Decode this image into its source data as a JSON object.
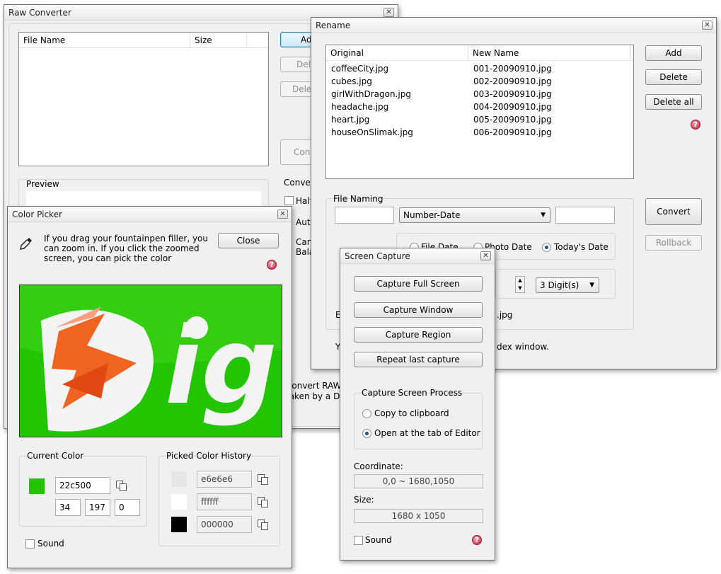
{
  "raw_converter": {
    "title": "Raw Converter",
    "columns": [
      "File Name",
      "Size"
    ],
    "buttons": {
      "add": "Add",
      "delete": "Delete",
      "delete_all": "Delete all",
      "convert": "Convert"
    },
    "preview_label": "Preview",
    "convert_group_label": "Conversion",
    "options": {
      "half": "Half",
      "auto": "Auto",
      "camera_balance": "Camera",
      "balance": "Balance"
    },
    "description": [
      "Convert RAW to",
      "taken by a DSLR"
    ]
  },
  "rename": {
    "title": "Rename",
    "columns": {
      "original": "Original",
      "new_name": "New Name"
    },
    "rows": [
      {
        "original": "coffeeCity.jpg",
        "new_name": "001-20090910.jpg"
      },
      {
        "original": "cubes.jpg",
        "new_name": "002-20090910.jpg"
      },
      {
        "original": "girlWithDragon.jpg",
        "new_name": "003-20090910.jpg"
      },
      {
        "original": "headache.jpg",
        "new_name": "004-20090910.jpg"
      },
      {
        "original": "heart.jpg",
        "new_name": "005-20090910.jpg"
      },
      {
        "original": "houseOnSlimak.jpg",
        "new_name": "006-20090910.jpg"
      }
    ],
    "buttons": {
      "add": "Add",
      "delete": "Delete",
      "delete_all": "Delete all",
      "convert": "Convert",
      "rollback": "Rollback"
    },
    "file_naming_label": "File Naming",
    "naming_select": "Number-Date",
    "date_options": {
      "file_date": "File Date",
      "photo_date": "Photo Date",
      "todays_date": "Today's Date"
    },
    "digits_select": "3 Digit(s)",
    "example_prefix": "E",
    "example_suffix": ".jpg",
    "footer_prefix": "Y",
    "footer_suffix": "dex window."
  },
  "color_picker": {
    "title": "Color Picker",
    "close_label": "Close",
    "instructions": [
      "If you drag your fountainpen filler, you",
      "can zoom in. If you click the zoomed",
      "screen, you can pick the color"
    ],
    "zoom_text": "ig",
    "current_color_label": "Current Color",
    "hex": "22c500",
    "r": "34",
    "g": "197",
    "b": "0",
    "current_color": "#22c500",
    "history_label": "Picked Color History",
    "history": [
      {
        "hex": "e6e6e6",
        "color": "#e6e6e6"
      },
      {
        "hex": "ffffff",
        "color": "#ffffff"
      },
      {
        "hex": "000000",
        "color": "#000000"
      }
    ],
    "sound_label": "Sound"
  },
  "screen_capture": {
    "title": "Screen Capture",
    "buttons": {
      "full": "Capture Full Screen",
      "window": "Capture Window",
      "region": "Capture Region",
      "repeat": "Repeat last capture"
    },
    "process_label": "Capture Screen Process",
    "options": {
      "clipboard": "Copy to clipboard",
      "editor": "Open at the tab of Editor"
    },
    "coordinate_label": "Coordinate:",
    "coordinate_value": "0,0 ~ 1680,1050",
    "size_label": "Size:",
    "size_value": "1680 x 1050",
    "sound_label": "Sound"
  }
}
